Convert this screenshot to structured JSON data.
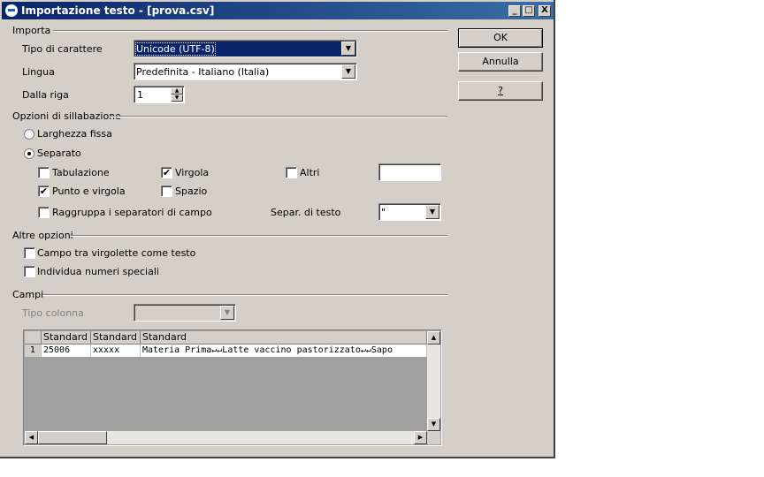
{
  "window": {
    "title": "Importazione testo - [prova.csv]",
    "buttons": {
      "minimize": "_",
      "maximize": "□",
      "close": "X"
    }
  },
  "import": {
    "section": "Importa",
    "charset_label": "Tipo di carattere",
    "charset_value": "Unicode (UTF-8)",
    "language_label": "Lingua",
    "language_value": "Predefinita - Italiano (Italia)",
    "from_row_label": "Dalla riga",
    "from_row_value": "1"
  },
  "separator_options": {
    "section": "Opzioni di sillabazione",
    "fixed_width": "Larghezza fissa",
    "separated": "Separato",
    "tab": "Tabulazione",
    "comma": "Virgola",
    "other": "Altri",
    "semicolon": "Punto e virgola",
    "space": "Spazio",
    "merge": "Raggruppa i separatori di campo",
    "text_delimiter_label": "Separ. di testo",
    "text_delimiter_value": "\"",
    "checked": {
      "tab": false,
      "comma": true,
      "other": false,
      "semicolon": true,
      "space": false,
      "merge": false
    }
  },
  "other_options": {
    "section": "Altre opzioni",
    "quoted_as_text": "Campo tra virgolette come testo",
    "detect_special_numbers": "Individua numeri speciali"
  },
  "fields": {
    "section": "Campi",
    "column_type_label": "Tipo colonna",
    "column_type_value": "",
    "headers": [
      "Standard",
      "Standard",
      "Standard"
    ],
    "rows": [
      {
        "num": "1",
        "cells": [
          "25006",
          "xxxxx",
          "Materia Prima↵↵Latte vaccino pastorizzato↵↵Sapo"
        ]
      }
    ]
  },
  "actions": {
    "ok": "OK",
    "cancel": "Annulla",
    "help": "?"
  },
  "check_mark": "✔"
}
